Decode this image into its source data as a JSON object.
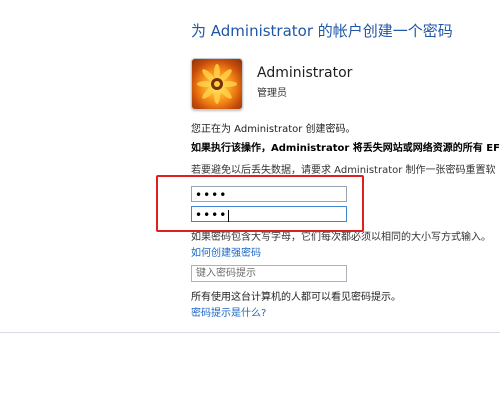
{
  "title": "为 Administrator 的帐户创建一个密码",
  "user": {
    "name": "Administrator",
    "role": "管理员"
  },
  "creating_text": "您正在为 Administrator 创建密码。",
  "warning_text": "如果执行该操作，Administrator 将丢失网站或网络资源的所有 EFS",
  "advice_text": "若要避免以后丢失数据，请要求 Administrator 制作一张密码重置软",
  "password": {
    "value": "••••"
  },
  "confirm_password": {
    "value": "••••"
  },
  "case_text": "如果密码包含大写字母，它们每次都必须以相同的大小写方式输入。",
  "strong_password_link": "如何创建强密码",
  "hint": {
    "placeholder": "键入密码提示"
  },
  "hint_visible_text": "所有使用这台计算机的人都可以看见密码提示。",
  "what_is_hint_link": "密码提示是什么?",
  "colors": {
    "title": "#1f56a8",
    "link": "#1b66c4",
    "highlight": "#e02020",
    "focus": "#3f86d1"
  }
}
